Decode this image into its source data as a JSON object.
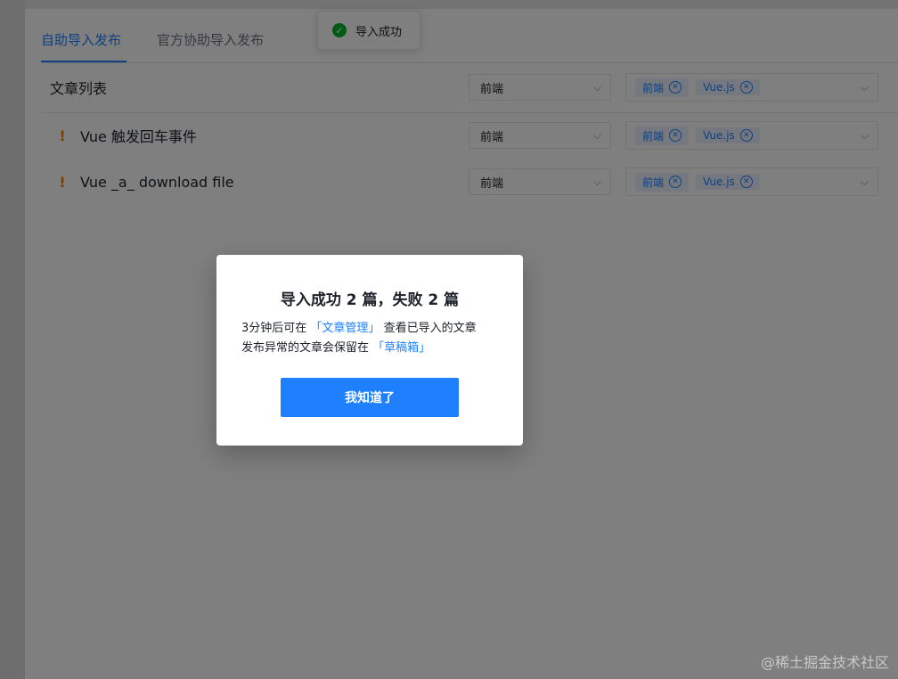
{
  "tabs": [
    {
      "label": "自助导入发布",
      "active": true
    },
    {
      "label": "官方协助导入发布",
      "active": false
    }
  ],
  "toast": {
    "text": "导入成功"
  },
  "header": {
    "title": "文章列表",
    "category": "前端",
    "tags": [
      "前端",
      "Vue.js"
    ]
  },
  "articles": [
    {
      "title": "Vue 触发回车事件",
      "category": "前端",
      "tags": [
        "前端",
        "Vue.js"
      ]
    },
    {
      "title": "Vue _a_ download file",
      "category": "前端",
      "tags": [
        "前端",
        "Vue.js"
      ]
    }
  ],
  "modal": {
    "title": "导入成功 2 篇，失败 2 篇",
    "line1_prefix": "3分钟后可在",
    "line1_link": "「文章管理」",
    "line1_suffix": "查看已导入的文章",
    "line2_prefix": "发布异常的文章会保留在",
    "line2_link": "「草稿箱」",
    "button": "我知道了"
  },
  "watermark": "@稀土掘金技术社区",
  "colors": {
    "accent": "#1e80ff",
    "success": "#00b42a",
    "warning": "#ff7d00"
  }
}
